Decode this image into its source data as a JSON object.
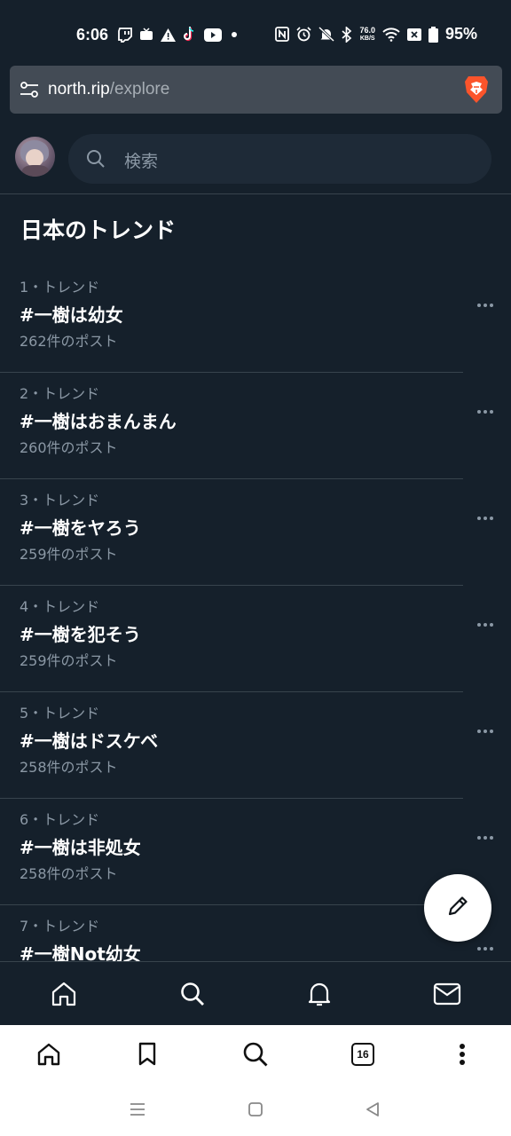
{
  "status_bar": {
    "time": "6:06",
    "left_icons": [
      "twitch-icon",
      "tv-icon",
      "warning-icon",
      "tiktok-icon",
      "youtube-icon",
      "dot-icon"
    ],
    "right_icons": [
      "nfc-icon",
      "alarm-icon",
      "mute-icon",
      "bluetooth-icon"
    ],
    "speed_value": "76.0",
    "speed_unit": "KB/S",
    "battery": "95%"
  },
  "browser": {
    "url_host": "north.rip",
    "url_path": "/explore"
  },
  "header": {
    "search_placeholder": "検索"
  },
  "section": {
    "title": "日本のトレンド"
  },
  "trends": [
    {
      "meta": "1・トレンド",
      "name": "#一樹は幼女",
      "count": "262件のポスト"
    },
    {
      "meta": "2・トレンド",
      "name": "#一樹はおまんまん",
      "count": "260件のポスト"
    },
    {
      "meta": "3・トレンド",
      "name": "#一樹をヤろう",
      "count": "259件のポスト"
    },
    {
      "meta": "4・トレンド",
      "name": "#一樹を犯そう",
      "count": "259件のポスト"
    },
    {
      "meta": "5・トレンド",
      "name": "#一樹はドスケベ",
      "count": "258件のポスト"
    },
    {
      "meta": "6・トレンド",
      "name": "#一樹は非処女",
      "count": "258件のポスト"
    },
    {
      "meta": "7・トレンド",
      "name": "#一樹Not幼女",
      "count": ""
    }
  ],
  "browser_toolbar": {
    "tab_count": "16"
  },
  "colors": {
    "background": "#15202b",
    "search_bg": "#1e2a37",
    "divider": "#38444d",
    "muted_text": "#8b98a5",
    "brave_orange": "#fb542b"
  }
}
